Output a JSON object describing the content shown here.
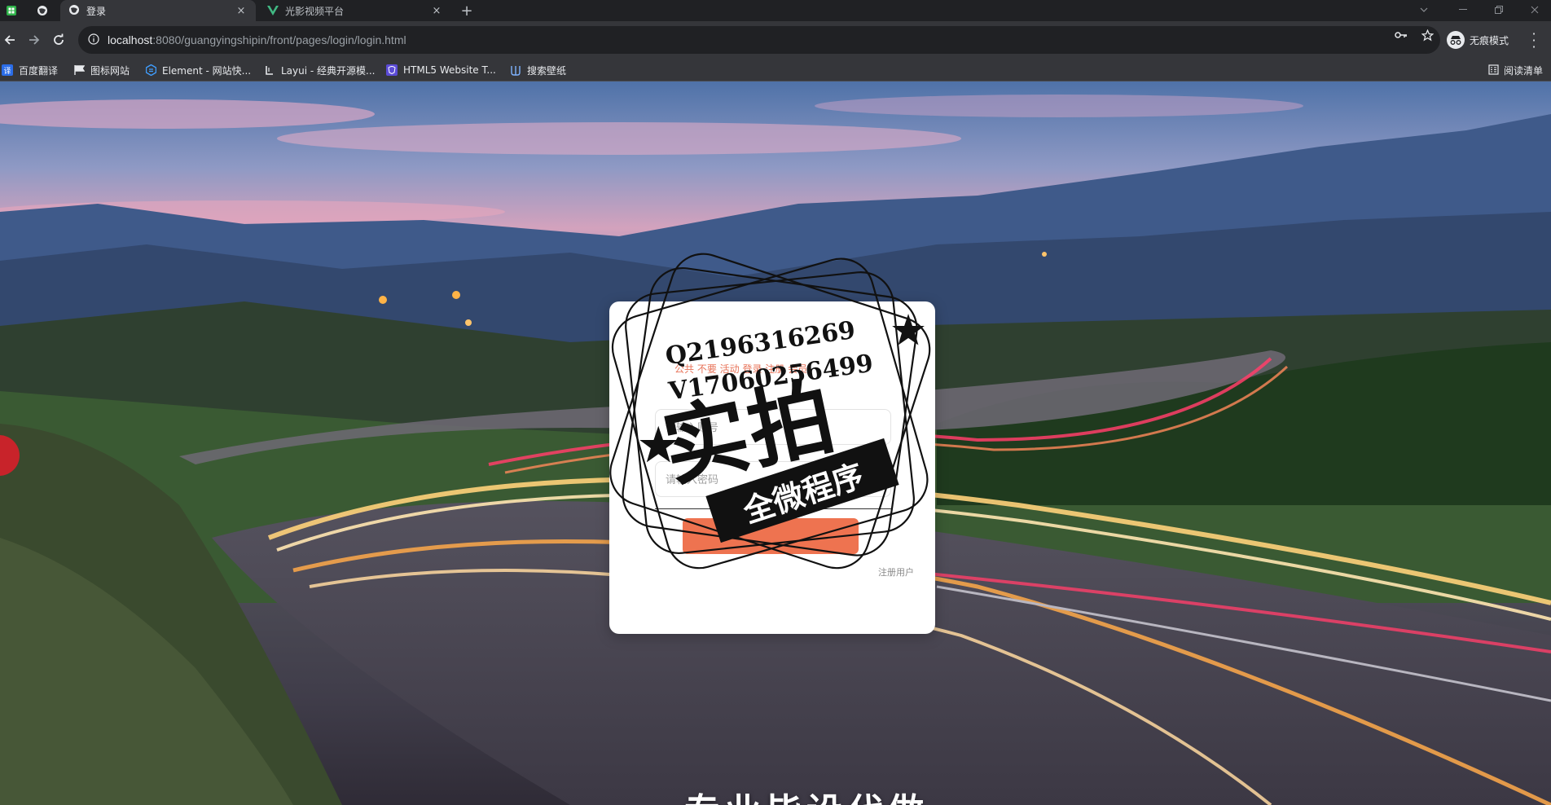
{
  "browser": {
    "tabs": [
      {
        "label": "登录",
        "active": true
      },
      {
        "label": "光影视频平台",
        "active": false
      }
    ],
    "close_glyph": "×",
    "new_tab_glyph": "+",
    "url_host": "localhost",
    "url_path": ":8080/guangyingshipin/front/pages/login/login.html",
    "incognito_label": "无痕模式",
    "reading_list_label": "阅读清单",
    "bookmarks": [
      {
        "label": "百度翻译",
        "icon": "translate-icon",
        "color": "#2b6de8"
      },
      {
        "label": "图标网站",
        "icon": "flag-icon",
        "color": "#35363a"
      },
      {
        "label": "Element - 网站快...",
        "icon": "element-icon",
        "color": "#409eff"
      },
      {
        "label": "Layui - 经典开源模...",
        "icon": "layui-icon",
        "color": "#35363a"
      },
      {
        "label": "HTML5 Website T...",
        "icon": "html5-icon",
        "color": "#5b4bd6"
      },
      {
        "label": "搜索壁纸",
        "icon": "wallpaper-icon",
        "color": "#35363a"
      }
    ]
  },
  "login": {
    "notice": "公共 不要 活动 登录 注册 会员",
    "username_placeholder": "请输入账号",
    "password_placeholder": "请输入密码",
    "button_label": "",
    "register_link": "注册用户"
  },
  "watermark": {
    "line1": "Q2196316269",
    "line2": "V17060256499",
    "big_text": "实拍",
    "ribbon_text": "全微程序"
  },
  "bottom_caption": "专业毕设代做",
  "colors": {
    "accent": "#ee7350",
    "chrome_dark": "#202124",
    "chrome_mid": "#35363a"
  }
}
